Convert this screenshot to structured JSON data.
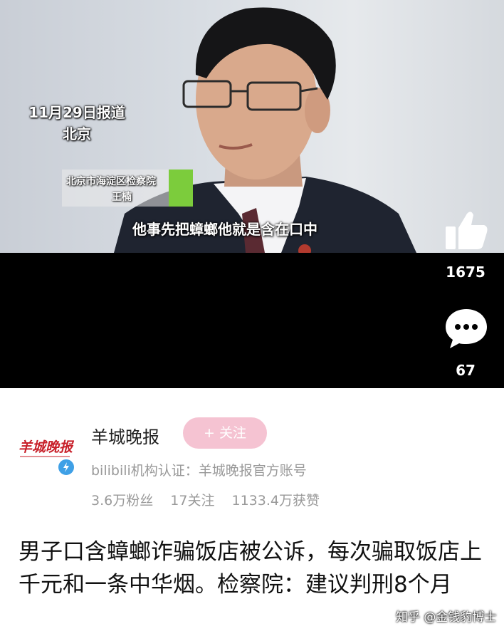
{
  "video": {
    "report_date": "11月29日报道",
    "location": "北京",
    "nameplate_org": "北京市海淀区检察院",
    "nameplate_name": "王楠",
    "subtitle": "他事先把蟑螂他就是含在口中",
    "like_count": "1675",
    "comment_count": "67",
    "icons": [
      "thumbs-up-icon",
      "comment-bubble-icon"
    ]
  },
  "account": {
    "logo_text": "羊城晚报",
    "name": "羊城晚报",
    "follow_label": "+ 关注",
    "certification": "bilibili机构认证：羊城晚报官方账号",
    "stats": [
      "3.6万粉丝",
      "17关注",
      "1133.4万获赞"
    ]
  },
  "headline": "男子口含蟑螂诈骗饭店被公诉，每次骗取饭店上千元和一条中华烟。检察院：建议判刑8个月",
  "watermark": "知乎 @金钱豹博士",
  "colors": {
    "follow_button": "#f5c3d2",
    "verify_badge": "#3fa0e6",
    "nameplate_accent": "#7ccc3c"
  }
}
